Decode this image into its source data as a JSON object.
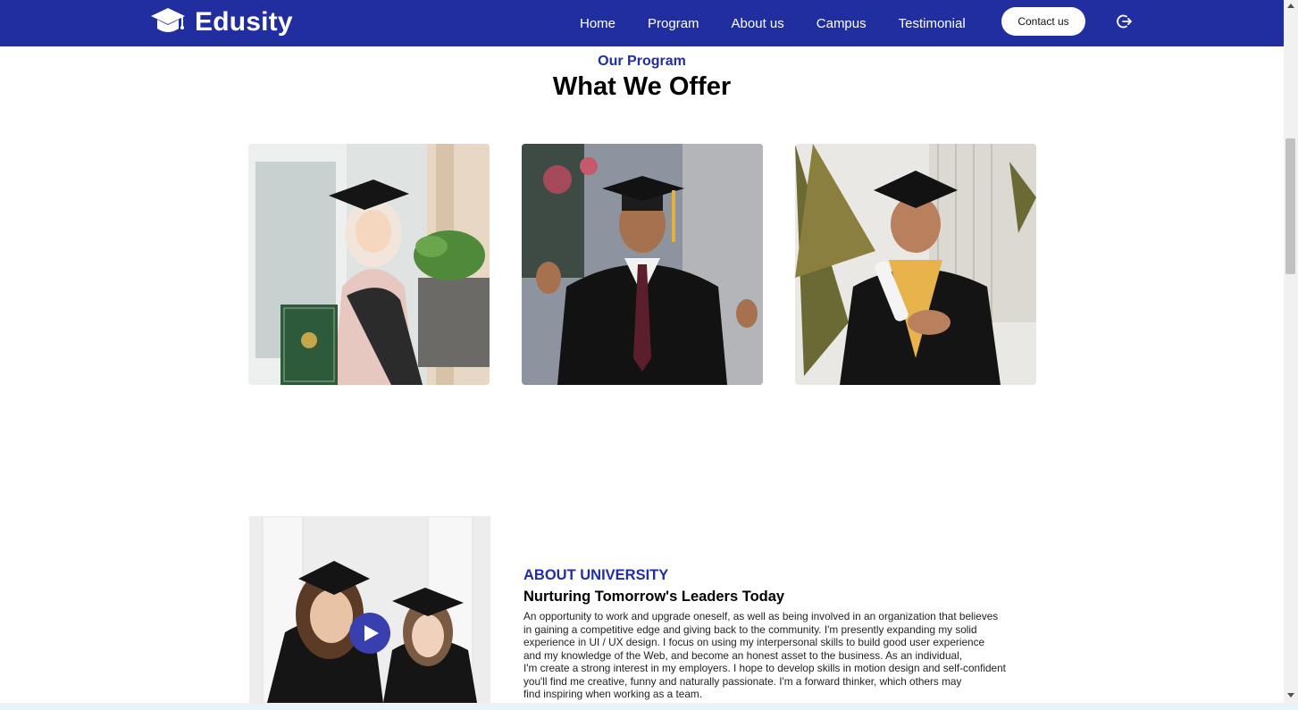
{
  "brand": {
    "name": "Edusity",
    "icon": "graduation-cap-icon"
  },
  "nav": {
    "links": [
      "Home",
      "Program",
      "About us",
      "Campus",
      "Testimonial"
    ],
    "contact_label": "Contact us",
    "logout_icon": "logout-icon"
  },
  "program": {
    "subtitle": "Our Program",
    "title": "What We Offer",
    "cards": [
      {
        "image": "graduate-woman-hijab-photo"
      },
      {
        "image": "graduate-man-smiling-photo"
      },
      {
        "image": "graduate-man-diploma-photo"
      }
    ]
  },
  "about": {
    "image": "two-graduates-photo",
    "play_icon": "play-icon",
    "tag": "ABOUT UNIVERSITY",
    "title": "Nurturing Tomorrow's Leaders Today",
    "lines": [
      "An opportunity to work and upgrade oneself, as well as being involved in an organization that believes",
      "in gaining a competitive edge and giving back to the community. I'm presently expanding my solid",
      "experience in UI / UX design. I focus on using my interpersonal skills to build good user experience",
      "and my knowledge of the Web, and become an honest asset to the business. As an individual,",
      "I'm create a strong interest in my employers. I hope to develop skills in motion design and self-confident",
      "you'll find me creative, funny and naturally passionate. I'm a forward thinker, which others may",
      "find inspiring when working as a team."
    ]
  },
  "colors": {
    "primary": "#212ea0",
    "background": "#ffffff"
  }
}
